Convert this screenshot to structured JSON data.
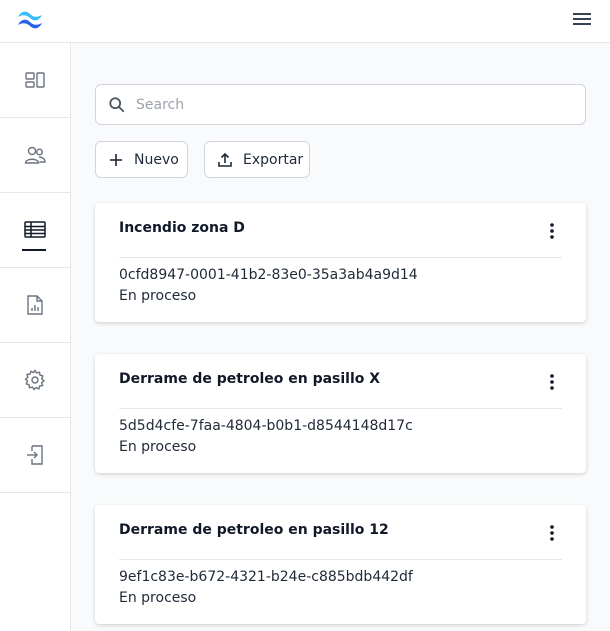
{
  "header": {
    "logo_icon": "tailwind-wave-logo",
    "menu_icon": "hamburger-menu-icon",
    "logo_color": "#38bdf8",
    "logo_color_dark": "#2563eb"
  },
  "sidebar": {
    "items": [
      {
        "icon": "dashboard-icon",
        "active": false
      },
      {
        "icon": "users-icon",
        "active": false
      },
      {
        "icon": "table-icon",
        "active": true
      },
      {
        "icon": "report-file-icon",
        "active": false
      },
      {
        "icon": "settings-gear-icon",
        "active": false
      },
      {
        "icon": "logout-icon",
        "active": false
      }
    ]
  },
  "search": {
    "placeholder": "Search",
    "value": ""
  },
  "toolbar": {
    "new_label": "Nuevo",
    "export_label": "Exportar"
  },
  "cards": [
    {
      "title": "Incendio zona D",
      "id": "0cfd8947-0001-41b2-83e0-35a3ab4a9d14",
      "status": "En proceso"
    },
    {
      "title": "Derrame de petroleo en pasillo X",
      "id": "5d5d4cfe-7faa-4804-b0b1-d8544148d17c",
      "status": "En proceso"
    },
    {
      "title": "Derrame de petroleo en pasillo 12",
      "id": "9ef1c83e-b672-4321-b24e-c885bdb442df",
      "status": "En proceso"
    }
  ]
}
